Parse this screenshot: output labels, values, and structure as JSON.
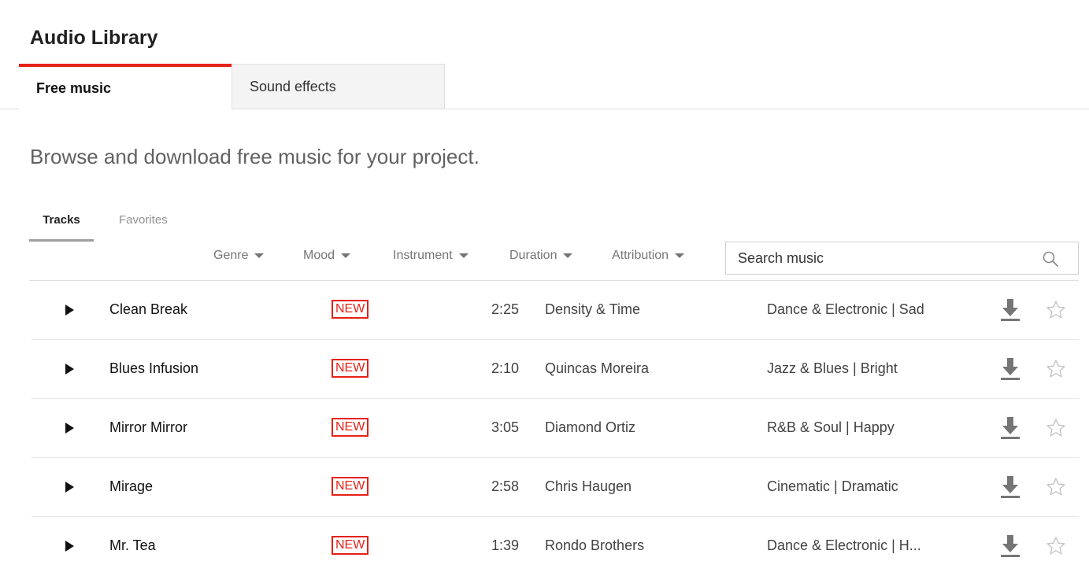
{
  "page": {
    "title": "Audio Library",
    "intro": "Browse and download free music for your project."
  },
  "main_tabs": [
    {
      "label": "Free music",
      "active": true
    },
    {
      "label": "Sound effects",
      "active": false
    }
  ],
  "sub_tabs": [
    {
      "label": "Tracks",
      "active": true
    },
    {
      "label": "Favorites",
      "active": false
    }
  ],
  "filters": [
    {
      "label": "Genre"
    },
    {
      "label": "Mood"
    },
    {
      "label": "Instrument"
    },
    {
      "label": "Duration"
    },
    {
      "label": "Attribution"
    }
  ],
  "search": {
    "placeholder": "Search music"
  },
  "badge_label": "NEW",
  "tracks": [
    {
      "title": "Clean Break",
      "duration": "2:25",
      "artist": "Density & Time",
      "genre_mood": "Dance & Electronic | Sad"
    },
    {
      "title": "Blues Infusion",
      "duration": "2:10",
      "artist": "Quincas Moreira",
      "genre_mood": "Jazz & Blues | Bright"
    },
    {
      "title": "Mirror Mirror",
      "duration": "3:05",
      "artist": "Diamond Ortiz",
      "genre_mood": "R&B & Soul | Happy"
    },
    {
      "title": "Mirage",
      "duration": "2:58",
      "artist": "Chris Haugen",
      "genre_mood": "Cinematic | Dramatic"
    },
    {
      "title": "Mr. Tea",
      "duration": "1:39",
      "artist": "Rondo Brothers",
      "genre_mood": "Dance & Electronic | H..."
    }
  ],
  "colors": {
    "accent": "#e62117",
    "badge": "#e62117",
    "icon_gray": "#757575"
  },
  "icons": {
    "play": "play-icon",
    "download": "download-icon",
    "favorite": "star-outline-icon",
    "search": "search-icon",
    "dropdown": "caret-down-icon"
  }
}
